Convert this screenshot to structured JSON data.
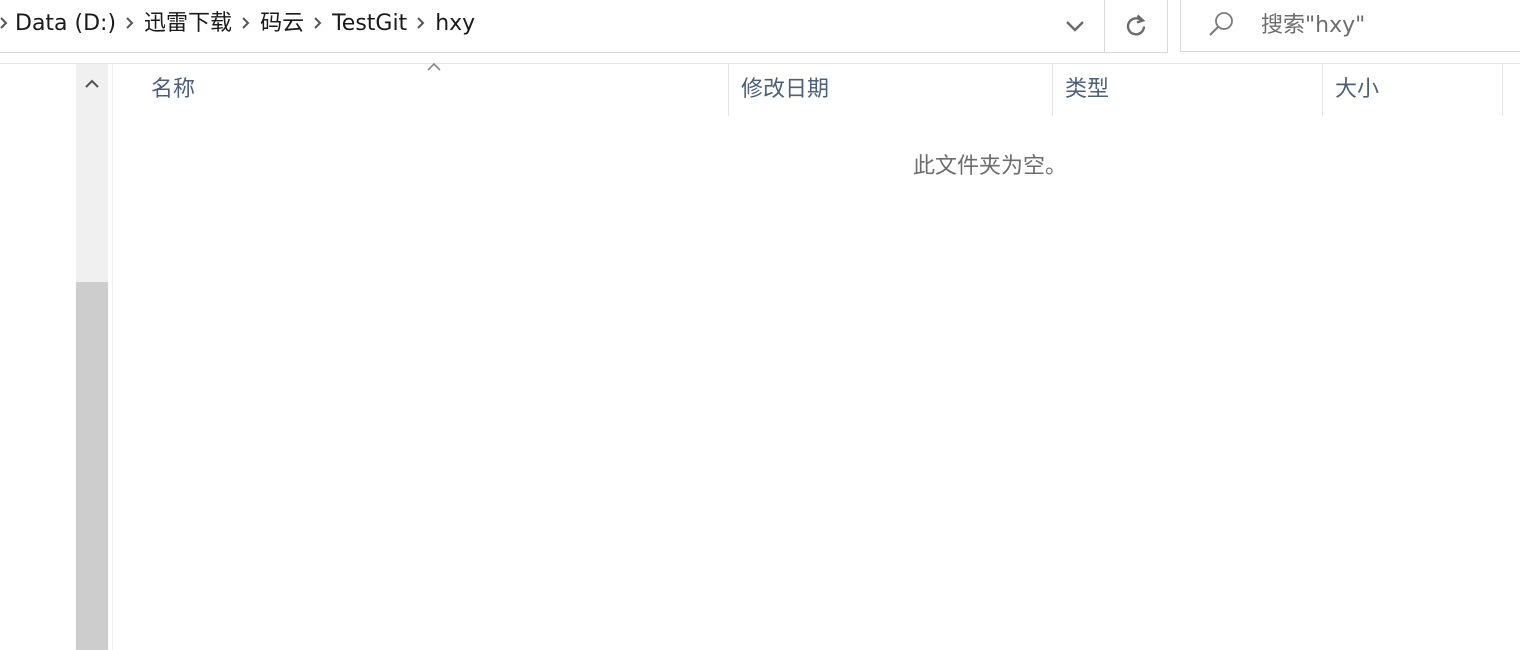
{
  "address_bar": {
    "breadcrumbs": [
      "Data (D:)",
      "迅雷下载",
      "码云",
      "TestGit",
      "hxy"
    ]
  },
  "search": {
    "placeholder": "搜索\"hxy\""
  },
  "columns": {
    "name": "名称",
    "date_modified": "修改日期",
    "type": "类型",
    "size": "大小"
  },
  "content": {
    "empty_message": "此文件夹为空。"
  },
  "colors": {
    "header_text": "#4c607a",
    "scroll_thumb": "#cdcdcd",
    "scroll_track": "#f0f0f0"
  }
}
